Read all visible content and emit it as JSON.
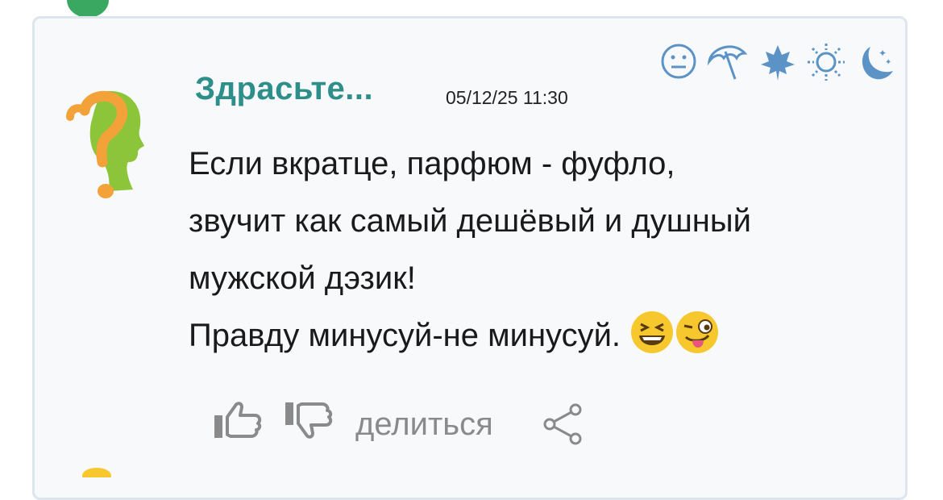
{
  "comment": {
    "username": "Здрасьте...",
    "timestamp": "05/12/25 11:30",
    "lines": [
      "Если вкратце, парфюм - фуфло,",
      "звучит как самый дешёвый и душный",
      "мужской дэзик!",
      "Правду минусуй-не минусуй."
    ],
    "emojis": [
      "grinning-squinting-emoji",
      "winking-tongue-emoji"
    ]
  },
  "mood_icons": [
    "neutral-face-icon",
    "umbrella-icon",
    "maple-leaf-icon",
    "sun-icon",
    "moon-stars-icon"
  ],
  "actions": {
    "like_icon": "thumbs-up-icon",
    "dislike_icon": "thumbs-down-icon",
    "share_label": "делиться",
    "share_icon": "share-icon"
  },
  "colors": {
    "username": "#2e8e8a",
    "mood_icons": "#5b93c7",
    "action_icons": "#8a8a8a",
    "card_border": "#dde6ee",
    "card_bg": "#f7f9fb"
  }
}
